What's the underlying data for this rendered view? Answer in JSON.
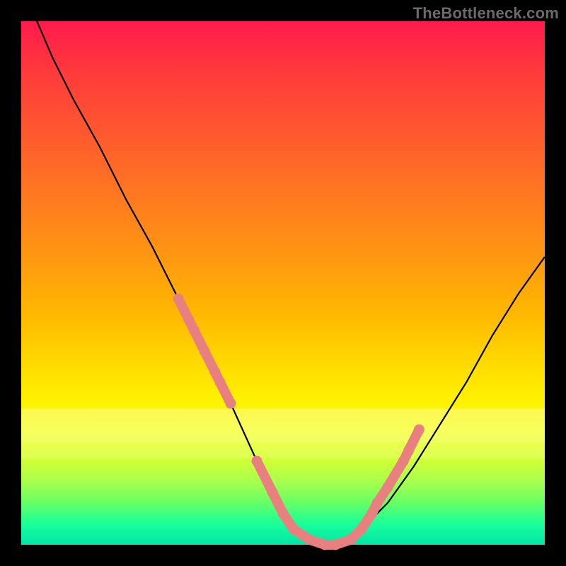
{
  "watermark": "TheBottleneck.com",
  "colors": {
    "frame": "#000000",
    "line": "#000000",
    "marker": "#e98080"
  },
  "chart_data": {
    "type": "line",
    "title": "",
    "xlabel": "",
    "ylabel": "",
    "xlim": [
      0,
      100
    ],
    "ylim": [
      0,
      100
    ],
    "grid": false,
    "legend": false,
    "series": [
      {
        "name": "curve",
        "x": [
          3,
          6,
          10,
          15,
          20,
          25,
          30,
          35,
          40,
          45,
          48,
          50,
          52,
          55,
          58,
          60,
          63,
          65,
          70,
          75,
          80,
          85,
          90,
          95,
          100
        ],
        "y": [
          100,
          93,
          85,
          76,
          66,
          57,
          47,
          37,
          27,
          16,
          10,
          6,
          3,
          1,
          0,
          0,
          1,
          3,
          8,
          15,
          23,
          31,
          40,
          48,
          55
        ]
      }
    ],
    "markers": {
      "name": "highlight-cluster",
      "color": "#e98080",
      "points": [
        {
          "x": 30,
          "y": 47
        },
        {
          "x": 32,
          "y": 43
        },
        {
          "x": 33,
          "y": 41
        },
        {
          "x": 35,
          "y": 37
        },
        {
          "x": 37,
          "y": 33
        },
        {
          "x": 38,
          "y": 31
        },
        {
          "x": 40,
          "y": 27
        },
        {
          "x": 45,
          "y": 16
        },
        {
          "x": 48,
          "y": 10
        },
        {
          "x": 50,
          "y": 6
        },
        {
          "x": 52,
          "y": 3
        },
        {
          "x": 55,
          "y": 1
        },
        {
          "x": 58,
          "y": 0
        },
        {
          "x": 60,
          "y": 0
        },
        {
          "x": 63,
          "y": 1
        },
        {
          "x": 65,
          "y": 3
        },
        {
          "x": 67,
          "y": 6
        },
        {
          "x": 68,
          "y": 8
        },
        {
          "x": 70,
          "y": 11
        },
        {
          "x": 73,
          "y": 16
        },
        {
          "x": 74,
          "y": 18
        },
        {
          "x": 76,
          "y": 22
        }
      ]
    }
  }
}
